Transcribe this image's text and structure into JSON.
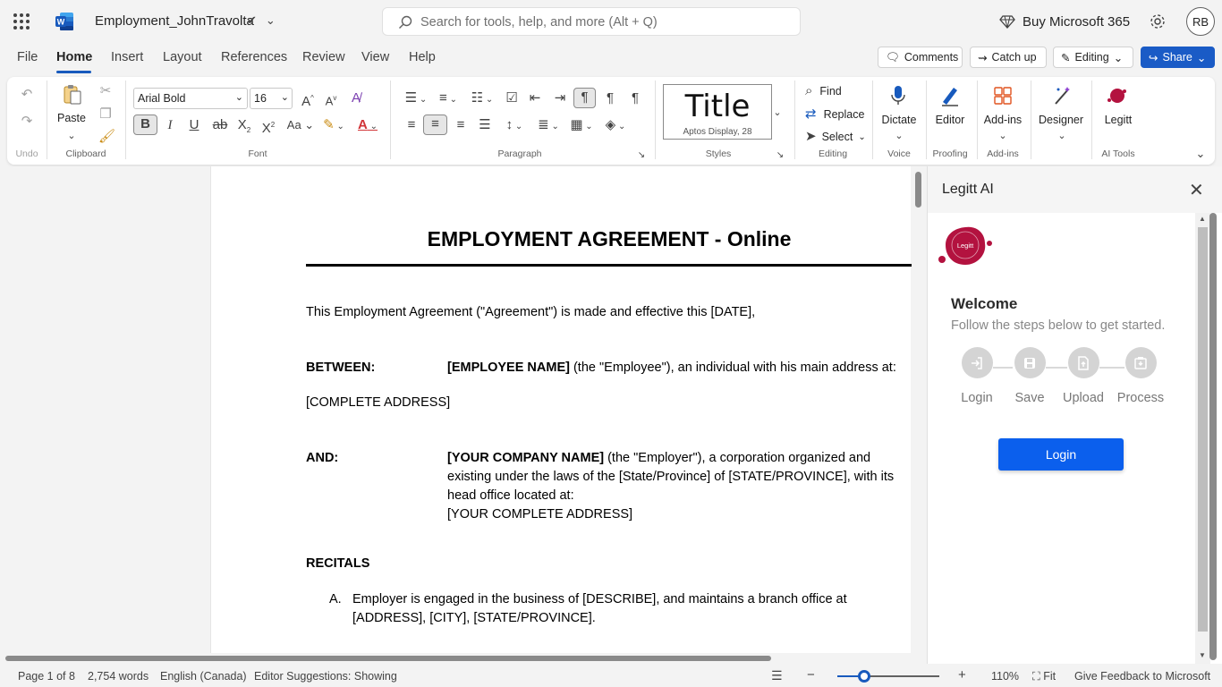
{
  "titlebar": {
    "doc_title": "Employment_JohnTravolta",
    "search_placeholder": "Search for tools, help, and more (Alt + Q)",
    "buy365": "Buy Microsoft 365",
    "avatar": "RB"
  },
  "tabs": [
    {
      "label": "File"
    },
    {
      "label": "Home",
      "active": true
    },
    {
      "label": "Insert"
    },
    {
      "label": "Layout"
    },
    {
      "label": "References"
    },
    {
      "label": "Review"
    },
    {
      "label": "View"
    },
    {
      "label": "Help"
    }
  ],
  "topbuttons": {
    "comments": "Comments",
    "catchup": "Catch up",
    "editing": "Editing",
    "share": "Share"
  },
  "ribbon": {
    "undo_label": "Undo",
    "paste": "Paste",
    "clipboard_label": "Clipboard",
    "font_name": "Arial Bold",
    "font_size": "16",
    "font_label": "Font",
    "paragraph_label": "Paragraph",
    "style_big": "Title",
    "style_small": "Aptos Display, 28",
    "styles_label": "Styles",
    "find": "Find",
    "replace": "Replace",
    "select": "Select",
    "editing_label": "Editing",
    "dictate": "Dictate",
    "voice_label": "Voice",
    "editor": "Editor",
    "proofing_label": "Proofing",
    "addins": "Add-ins",
    "addins_label": "Add-ins",
    "designer": "Designer",
    "legitt": "Legitt",
    "aitools_label": "AI Tools"
  },
  "document": {
    "heading": "EMPLOYMENT AGREEMENT - Online",
    "intro": "This Employment Agreement (\"Agreement\") is made and effective this [DATE],",
    "between_label": "BETWEEN:",
    "employee_bold": "[EMPLOYEE NAME]",
    "employee_rest": " (the \"Employee\"), an individual with his main address at:",
    "employee_address": "[COMPLETE ADDRESS]",
    "and_label": "AND:",
    "company_bold": "[YOUR COMPANY NAME]",
    "company_line1_rest": " (the \"Employer\"), a corporation organized and",
    "company_line2": "existing under the laws of the [State/Province] of [STATE/PROVINCE], with its",
    "company_line3": "head office located at:",
    "company_address": "[YOUR COMPLETE ADDRESS]",
    "recitals": "RECITALS",
    "recital_a_marker": "A.",
    "recital_a_line1": "Employer is engaged in the business of [DESCRIBE], and maintains a branch office at",
    "recital_a_line2": "[ADDRESS], [CITY], [STATE/PROVINCE]."
  },
  "panel": {
    "title": "Legitt AI",
    "logo_text": "Legitt",
    "welcome": "Welcome",
    "subtitle": "Follow the steps below to get started.",
    "steps": [
      {
        "label": "Login",
        "icon": "login-icon"
      },
      {
        "label": "Save",
        "icon": "save-icon"
      },
      {
        "label": "Upload",
        "icon": "upload-icon"
      },
      {
        "label": "Process",
        "icon": "process-icon"
      }
    ],
    "login_button": "Login"
  },
  "statusbar": {
    "page": "Page 1 of 8",
    "words": "2,754 words",
    "language": "English (Canada)",
    "editor": "Editor Suggestions: Showing",
    "zoom": "110%",
    "fit": "Fit",
    "feedback": "Give Feedback to Microsoft"
  },
  "colors": {
    "accent": "#185abd",
    "share": "#1a5bc6",
    "legitt": "#b3123f",
    "login_button": "#0b5fed"
  }
}
